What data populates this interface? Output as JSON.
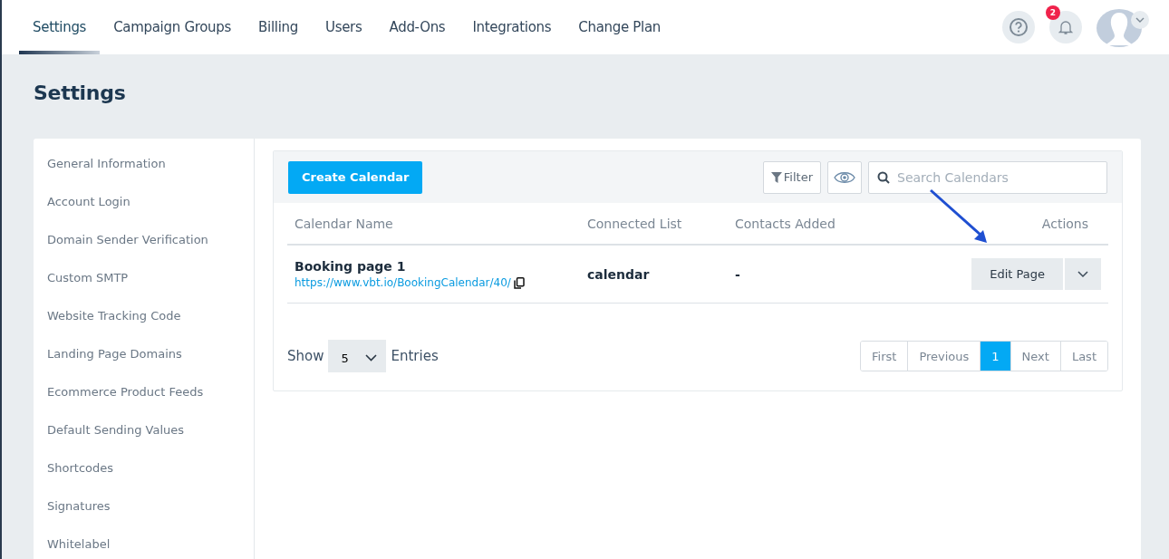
{
  "nav": {
    "tabs": [
      {
        "label": "Settings",
        "selected": true
      },
      {
        "label": "Campaign Groups",
        "selected": false
      },
      {
        "label": "Billing",
        "selected": false
      },
      {
        "label": "Users",
        "selected": false
      },
      {
        "label": "Add-Ons",
        "selected": false
      },
      {
        "label": "Integrations",
        "selected": false
      },
      {
        "label": "Change Plan",
        "selected": false
      }
    ],
    "notification_count": "2"
  },
  "page_title": "Settings",
  "sidebar": {
    "items": [
      "General Information",
      "Account Login",
      "Domain Sender Verification",
      "Custom SMTP",
      "Website Tracking Code",
      "Landing Page Domains",
      "Ecommerce Product Feeds",
      "Default Sending Values",
      "Shortcodes",
      "Signatures",
      "Whitelabel"
    ]
  },
  "toolbar": {
    "create_button": "Create Calendar",
    "filter_button": "Filter",
    "search": {
      "placeholder": "Search Calendars"
    }
  },
  "table": {
    "columns": [
      "Calendar Name",
      "Connected List",
      "Contacts Added",
      "Actions"
    ],
    "rows": [
      {
        "name": "Booking page 1",
        "url": "https://www.vbt.io/BookingCalendar/40/",
        "connected_list": "calendar",
        "contacts_added": "-",
        "action": "Edit Page"
      }
    ]
  },
  "footer": {
    "show_label": "Show",
    "page_size": "5",
    "entries_label": "Entries",
    "pagination": [
      {
        "label": "First",
        "selected": false
      },
      {
        "label": "Previous",
        "selected": false
      },
      {
        "label": "1",
        "selected": true
      },
      {
        "label": "Next",
        "selected": false
      },
      {
        "label": "Last",
        "selected": false
      }
    ]
  }
}
